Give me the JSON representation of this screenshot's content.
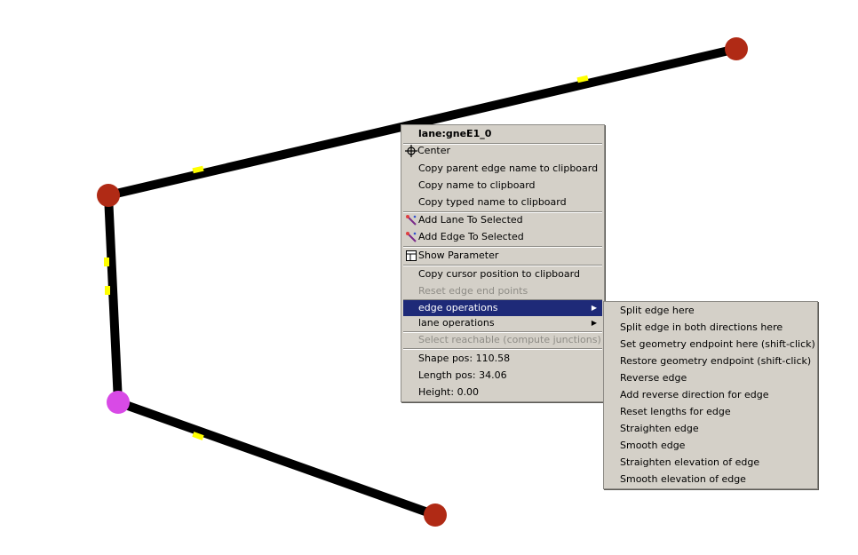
{
  "canvas": {
    "colors": {
      "edge": "#000000",
      "junction": "#b02a15",
      "selected_junction": "#d84ae6",
      "lane_label": "#ffff00"
    }
  },
  "context_menu": {
    "title": "lane:gneE1_0",
    "items": [
      {
        "label": "Center",
        "icon": "crosshair-icon"
      },
      {
        "label": "Copy parent edge name to clipboard"
      },
      {
        "label": "Copy name to clipboard"
      },
      {
        "label": "Copy typed name to clipboard"
      },
      {
        "label": "Add Lane To Selected",
        "icon": "select-wand-icon"
      },
      {
        "label": "Add Edge To Selected",
        "icon": "select-wand-icon"
      },
      {
        "label": "Show Parameter",
        "icon": "parameter-table-icon"
      },
      {
        "label": "Copy cursor position to clipboard"
      },
      {
        "label": "Reset edge end points",
        "disabled": true
      },
      {
        "label": "edge operations",
        "highlighted": true,
        "submenu": true
      },
      {
        "label": "lane operations",
        "submenu": true
      },
      {
        "label": "Select reachable (compute junctions)",
        "disabled": true
      },
      {
        "label": "Shape pos: 110.58"
      },
      {
        "label": "Length pos: 34.06"
      },
      {
        "label": "Height: 0.00"
      }
    ]
  },
  "edge_operations_submenu": {
    "items": [
      "Split edge here",
      "Split edge in both directions here",
      "Set geometry endpoint here (shift-click)",
      "Restore geometry endpoint (shift-click)",
      "Reverse edge",
      "Add reverse direction for edge",
      "Reset lengths for edge",
      "Straighten edge",
      "Smooth edge",
      "Straighten elevation of edge",
      "Smooth elevation of edge"
    ]
  }
}
